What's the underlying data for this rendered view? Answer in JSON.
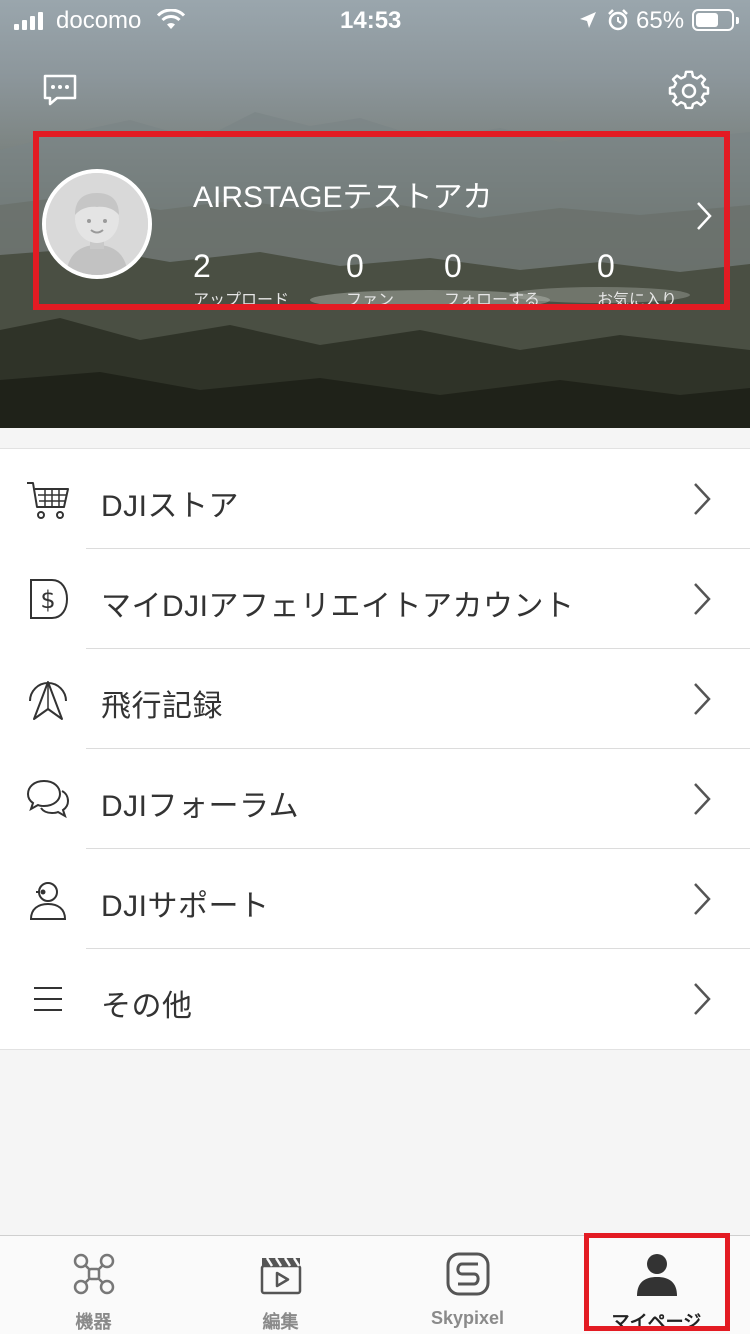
{
  "status_bar": {
    "carrier": "docomo",
    "time": "14:53",
    "battery_percent": "65%",
    "battery_level": 0.65,
    "icons": [
      "signal-icon",
      "wifi-icon",
      "location-arrow-icon",
      "alarm-icon",
      "battery-icon"
    ]
  },
  "header": {
    "message_icon": "chat-bubble-icon",
    "settings_icon": "gear-icon",
    "profile": {
      "username": "AIRSTAGEテストアカ",
      "avatar_icon": "default-avatar-icon",
      "stats": [
        {
          "value": "2",
          "label": "アップロード"
        },
        {
          "value": "0",
          "label": "ファン"
        },
        {
          "value": "0",
          "label": "フォローする"
        },
        {
          "value": "0",
          "label": "お気に入り"
        }
      ]
    }
  },
  "menu": {
    "items": [
      {
        "label": "DJIストア",
        "icon": "shopping-cart-icon"
      },
      {
        "label": "マイDJIアフェリエイトアカウント",
        "icon": "dollar-tag-icon"
      },
      {
        "label": "飛行記録",
        "icon": "flight-record-icon"
      },
      {
        "label": "DJIフォーラム",
        "icon": "chat-bubbles-icon"
      },
      {
        "label": "DJIサポート",
        "icon": "support-headset-icon"
      },
      {
        "label": "その他",
        "icon": "menu-lines-icon"
      }
    ]
  },
  "tabbar": {
    "tabs": [
      {
        "label": "機器",
        "icon": "drone-icon"
      },
      {
        "label": "編集",
        "icon": "clapperboard-icon"
      },
      {
        "label": "Skypixel",
        "icon": "skypixel-icon"
      },
      {
        "label": "マイページ",
        "icon": "person-icon"
      }
    ],
    "active": "マイページ"
  },
  "colors": {
    "highlight": "#e31b23",
    "menu_text": "#333333",
    "tab_inactive": "#8a8a8a"
  }
}
